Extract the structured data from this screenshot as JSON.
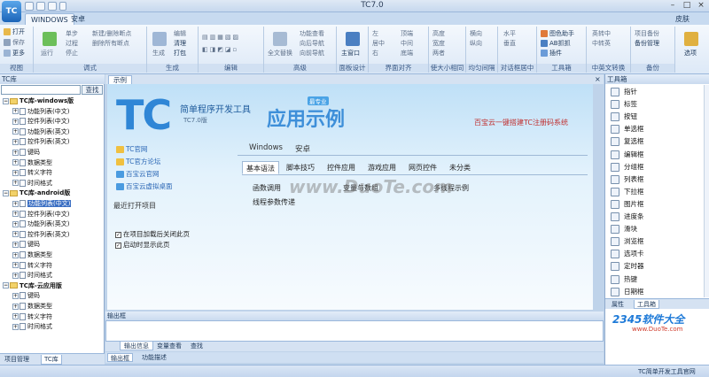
{
  "window": {
    "title": "TC7.0",
    "logo": "TC"
  },
  "ribbon": {
    "tabs": [
      "WINDOWS",
      "安卓"
    ],
    "skin": "皮肤",
    "groups": [
      {
        "label": "视图",
        "buttons": [
          "打开",
          "保存",
          "更多"
        ]
      },
      {
        "label": "调式",
        "buttons": [
          "运行",
          "单步",
          "过程",
          "停止",
          "新建/删除断点",
          "删除所有断点"
        ]
      },
      {
        "label": "生成",
        "buttons": [
          "生成",
          "编辑",
          "清理",
          "打包"
        ]
      },
      {
        "label": "编辑",
        "buttons": []
      },
      {
        "label": "高级",
        "buttons": [
          "全文替换",
          "功能查看",
          "向后导航",
          "向前导航"
        ]
      },
      {
        "label": "面板设计",
        "buttons": [
          "主窗口"
        ]
      },
      {
        "label": "界面对齐",
        "buttons": [
          "左",
          "居中",
          "右",
          "顶端",
          "中间",
          "底端"
        ]
      },
      {
        "label": "使大小相同",
        "buttons": [
          "高度",
          "宽度",
          "两者"
        ]
      },
      {
        "label": "均匀间隔",
        "buttons": [
          "横向",
          "纵向"
        ]
      },
      {
        "label": "对话框居中",
        "buttons": [
          "水平",
          "垂直"
        ]
      },
      {
        "label": "工具箱",
        "buttons": [
          "图色助手",
          "AB抓抓",
          "插件"
        ]
      },
      {
        "label": "中英文转换",
        "buttons": [
          "英转中",
          "中转英"
        ]
      },
      {
        "label": "备份",
        "buttons": [
          "项目备份",
          "备份管理"
        ]
      },
      {
        "label": "",
        "buttons": [
          "选项"
        ]
      }
    ]
  },
  "left_panel": {
    "title": "TC库",
    "search_button": "查找",
    "tree": [
      {
        "label": "TC库-windows版",
        "level": 0,
        "bold": true
      },
      {
        "label": "功能列表(中文)",
        "level": 1
      },
      {
        "label": "控件列表(中文)",
        "level": 1
      },
      {
        "label": "功能列表(英文)",
        "level": 1
      },
      {
        "label": "控件列表(英文)",
        "level": 1
      },
      {
        "label": "键码",
        "level": 1
      },
      {
        "label": "数据类型",
        "level": 1
      },
      {
        "label": "转义字符",
        "level": 1
      },
      {
        "label": "时间格式",
        "level": 1
      },
      {
        "label": "TC库-android版",
        "level": 0,
        "bold": true
      },
      {
        "label": "功能列表(中文)",
        "level": 1,
        "selected": true
      },
      {
        "label": "控件列表(中文)",
        "level": 1
      },
      {
        "label": "功能列表(英文)",
        "level": 1
      },
      {
        "label": "控件列表(英文)",
        "level": 1
      },
      {
        "label": "键码",
        "level": 1
      },
      {
        "label": "数据类型",
        "level": 1
      },
      {
        "label": "转义字符",
        "level": 1
      },
      {
        "label": "时间格式",
        "level": 1
      },
      {
        "label": "TC库-云应用版",
        "level": 0,
        "bold": true
      },
      {
        "label": "键码",
        "level": 1
      },
      {
        "label": "数据类型",
        "level": 1
      },
      {
        "label": "转义字符",
        "level": 1
      },
      {
        "label": "时间格式",
        "level": 1
      }
    ],
    "tabs": [
      "项目管理",
      "TC库"
    ]
  },
  "document": {
    "tab": "示例",
    "close": "×",
    "tc_logo": "TC",
    "tool_title": "简单程序开发工具",
    "tool_version": "TC7.0版",
    "sample_title": "应用示例",
    "sample_badge": "最专业",
    "promo": "百宝云一键搭建TC注册码系统",
    "links": [
      "TC官网",
      "TC官方论坛",
      "百宝云官网",
      "百宝云虚拟桌面"
    ],
    "recent_title": "最近打开项目",
    "checkbox1": "在项目加载后关闭此页",
    "checkbox2": "启动时显示此页",
    "platform_tabs": [
      "Windows",
      "安卓"
    ],
    "category_tabs": [
      "基本语法",
      "脚本技巧",
      "控件应用",
      "游戏应用",
      "网页控件",
      "未分类"
    ],
    "samples": [
      "函数调用",
      "变量与数组",
      "多线程示例",
      "线程参数传递"
    ],
    "watermark": "www.DuoTe.com"
  },
  "output": {
    "title": "输出框",
    "tabs": [
      "输出信息",
      "变量查看",
      "查找"
    ],
    "bottom_tabs": [
      "输出框",
      "功能描述"
    ]
  },
  "toolbox": {
    "title": "工具箱",
    "items": [
      "指针",
      "标签",
      "按钮",
      "单选框",
      "复选框",
      "编辑框",
      "分组框",
      "列表框",
      "下拉框",
      "图片框",
      "进度条",
      "滑块",
      "浏览框",
      "选项卡",
      "定时器",
      "热键",
      "日期框"
    ],
    "tabs": [
      "属性",
      "工具箱"
    ],
    "brand": "2345软件大全",
    "brand_url": "www.DuoTe.com"
  },
  "status": {
    "text": "TC简单开发工具官网"
  },
  "colors": {
    "accent": "#2f86d6",
    "ribbon": "#dde9f7",
    "selection": "#3b6fc3",
    "promo": "#c03030"
  }
}
